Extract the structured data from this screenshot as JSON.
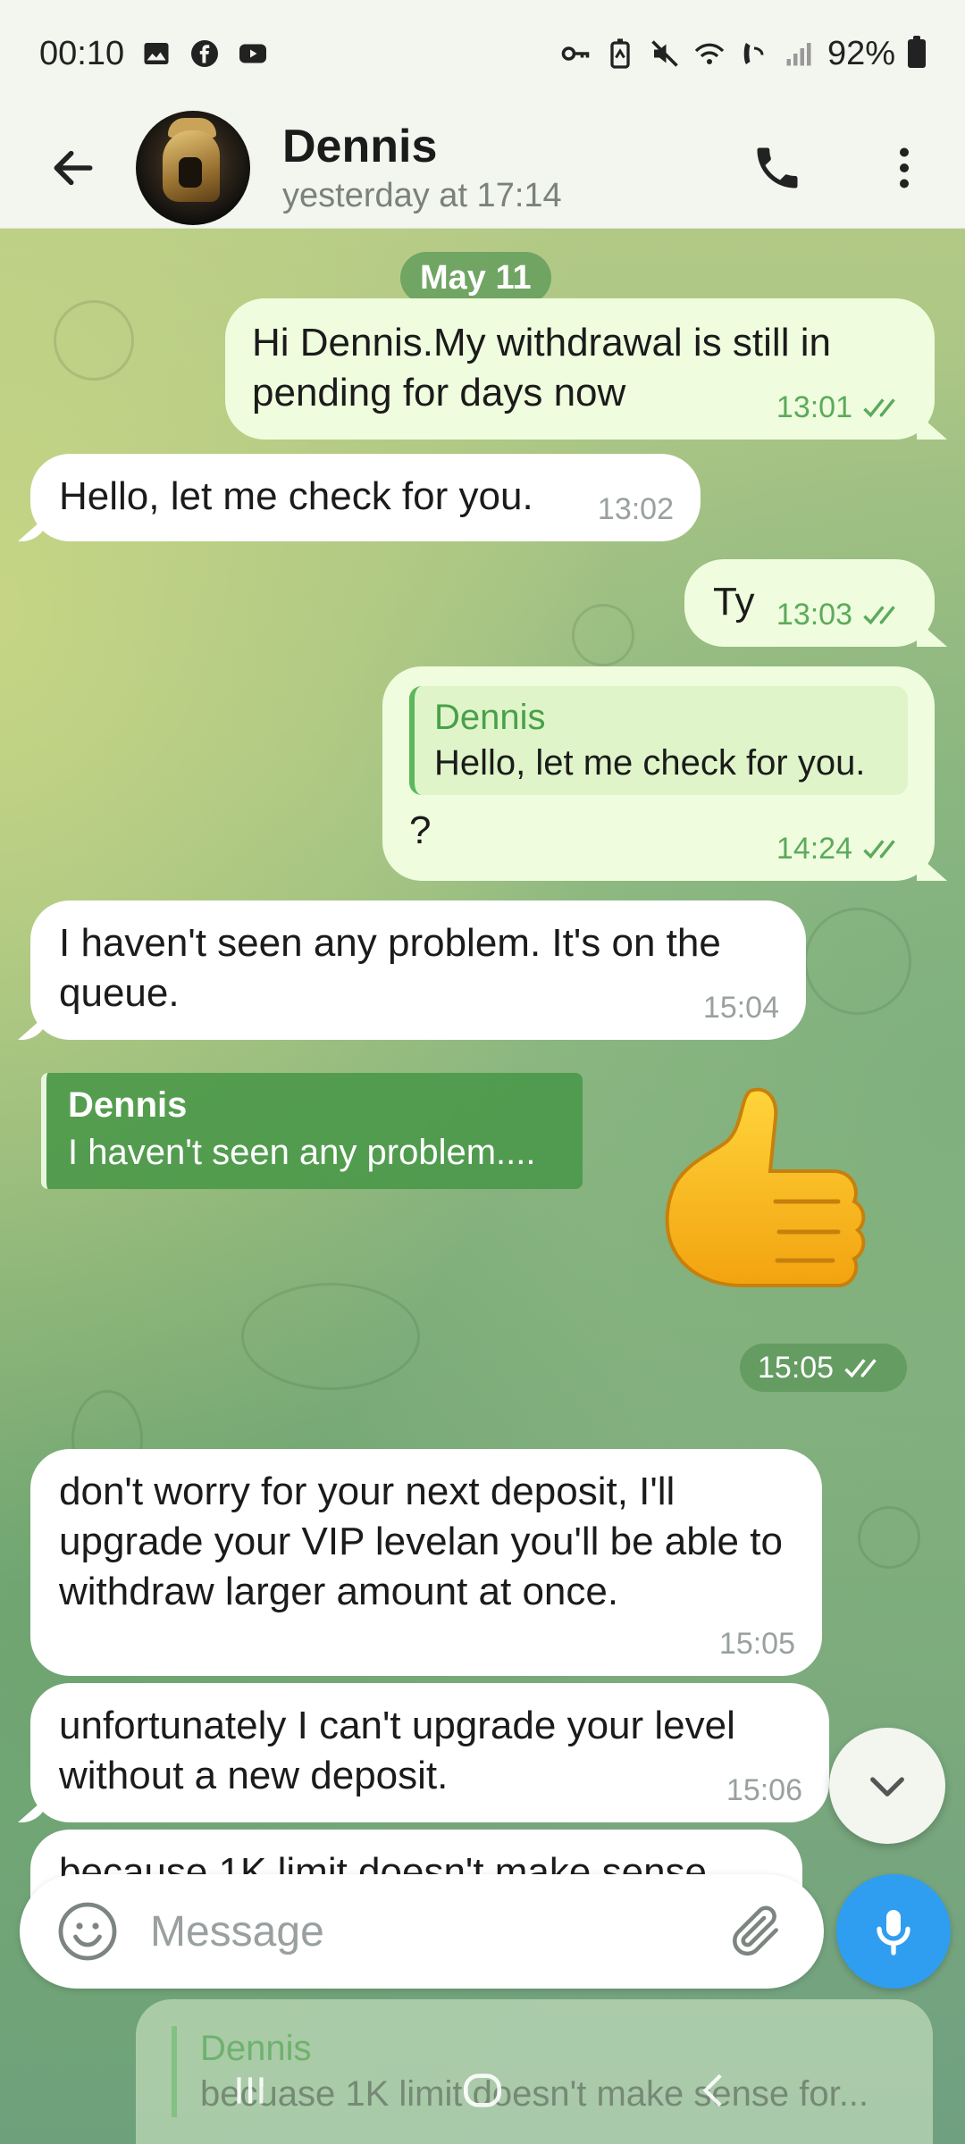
{
  "status_bar": {
    "time": "00:10",
    "battery": "92%",
    "left_icons": [
      "gallery-icon",
      "facebook-icon",
      "youtube-icon"
    ],
    "right_icons": [
      "vpn-key-icon",
      "battery-saver-icon",
      "mute-icon",
      "wifi-calling-icon",
      "volte-icon",
      "signal-icon",
      "battery-icon"
    ]
  },
  "header": {
    "name": "Dennis",
    "last_seen": "yesterday at 17:14"
  },
  "chat": {
    "date_separator": "May 11",
    "messages": [
      {
        "dir": "out",
        "text": "Hi Dennis.My withdrawal is still in pending for days now",
        "time": "13:01",
        "read": true
      },
      {
        "dir": "in",
        "text": "Hello, let me check for you.",
        "time": "13:02"
      },
      {
        "dir": "out",
        "text": "Ty",
        "time": "13:03",
        "read": true
      },
      {
        "dir": "out",
        "reply_to": {
          "name": "Dennis",
          "text": "Hello, let me check for you."
        },
        "text": "?",
        "time": "14:24",
        "read": true
      },
      {
        "dir": "in",
        "text": "I haven't seen any problem. It's on the queue.",
        "time": "15:04"
      },
      {
        "dir": "out",
        "sticker": "thumbs-up",
        "reply_to": {
          "name": "Dennis",
          "text": "I haven't seen any problem...."
        },
        "time": "15:05",
        "read": true
      },
      {
        "dir": "in",
        "text": "don't worry for your next deposit, I'll upgrade your VIP levelan you'll be able to withdraw larger amount at once.",
        "time": "15:05"
      },
      {
        "dir": "in",
        "text": "unfortunately I can't upgrade your level without a new deposit.",
        "time": "15:06"
      },
      {
        "dir": "in",
        "text": "because 1K limit doesn't make sense",
        "partial": true
      }
    ]
  },
  "input": {
    "placeholder": "Message"
  },
  "faded_preview": {
    "name": "Dennis",
    "text": "becuase 1K limit doesn't make sense for..."
  },
  "colors": {
    "accent_blue": "#2f9ef0",
    "outgoing_bubble": "#effdde",
    "incoming_bubble": "#ffffff",
    "reply_green": "#4aa04a"
  }
}
